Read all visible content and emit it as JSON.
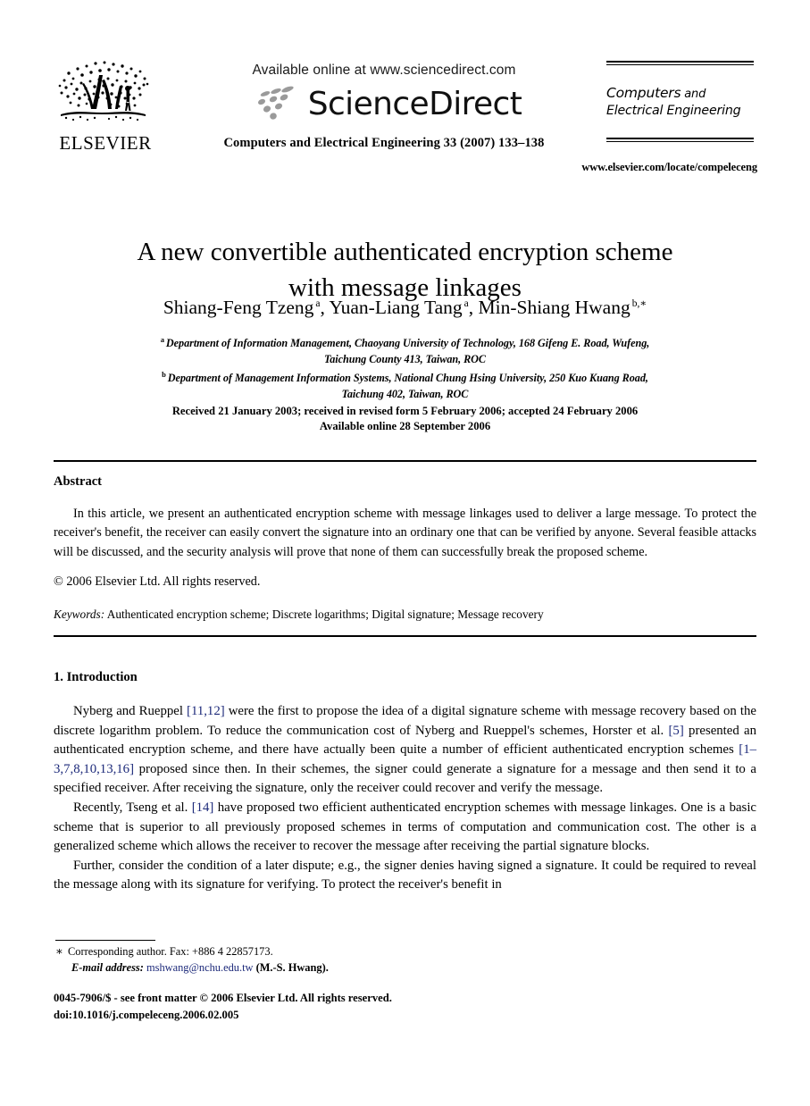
{
  "masthead": {
    "publisher_name": "ELSEVIER",
    "publisher_logo_icon": "elsevier-tree-icon",
    "available_online": "Available online at www.sciencedirect.com",
    "sciencedirect_wordmark": "ScienceDirect",
    "sciencedirect_logo_icon": "sciencedirect-swoosh-icon",
    "journal_reference": "Computers and Electrical Engineering 33 (2007) 133–138",
    "journal_logo_line1_strong": "Computers",
    "journal_logo_line1_weak": " and",
    "journal_logo_line2": "Electrical Engineering",
    "journal_url": "www.elsevier.com/locate/compeleceng"
  },
  "article": {
    "title_line1": "A new convertible authenticated encryption scheme",
    "title_line2": "with message linkages",
    "authors": [
      {
        "name": "Shiang-Feng Tzeng",
        "marker": "a",
        "sep": ", "
      },
      {
        "name": "Yuan-Liang Tang",
        "marker": "a",
        "sep": ", "
      },
      {
        "name": "Min-Shiang Hwang",
        "marker": "b,∗",
        "sep": ""
      }
    ],
    "affiliations": [
      {
        "marker": "a",
        "line1": "Department of Information Management, Chaoyang University of Technology, 168 Gifeng E. Road, Wufeng,",
        "line2": "Taichung County 413, Taiwan, ROC"
      },
      {
        "marker": "b",
        "line1": "Department of Management Information Systems, National Chung Hsing University, 250 Kuo Kuang Road,",
        "line2": "Taichung 402, Taiwan, ROC"
      }
    ],
    "dates_line1": "Received 21 January 2003; received in revised form 5 February 2006; accepted 24 February 2006",
    "dates_line2": "Available online 28 September 2006"
  },
  "abstract": {
    "heading": "Abstract",
    "text": "In this article, we present an authenticated encryption scheme with message linkages used to deliver a large message. To protect the receiver's benefit, the receiver can easily convert the signature into an ordinary one that can be verified by anyone. Several feasible attacks will be discussed, and the security analysis will prove that none of them can successfully break the proposed scheme.",
    "copyright": "© 2006 Elsevier Ltd. All rights reserved.",
    "keywords_label": "Keywords:",
    "keywords_value": "Authenticated encryption scheme; Discrete logarithms; Digital signature; Message recovery"
  },
  "section": {
    "heading": "1. Introduction",
    "paragraph1_a": "Nyberg and Rueppel ",
    "paragraph1_cite1": "[11,12]",
    "paragraph1_b": " were the first to propose the idea of a digital signature scheme with message recovery based on the discrete logarithm problem. To reduce the communication cost of Nyberg and Rueppel's schemes, Horster et al. ",
    "paragraph1_cite2": "[5]",
    "paragraph1_c": " presented an authenticated encryption scheme, and there have actually been quite a number of efficient authenticated encryption schemes ",
    "paragraph1_cite3": "[1–3,7,8,10,13,16]",
    "paragraph1_d": " proposed since then. In their schemes, the signer could generate a signature for a message and then send it to a specified receiver. After receiving the signature, only the receiver could recover and verify the message.",
    "paragraph2_a": "Recently, Tseng et al. ",
    "paragraph2_cite1": "[14]",
    "paragraph2_b": " have proposed two efficient authenticated encryption schemes with message linkages. One is a basic scheme that is superior to all previously proposed schemes in terms of computation and communication cost. The other is a generalized scheme which allows the receiver to recover the message after receiving the partial signature blocks.",
    "paragraph3": "Further, consider the condition of a later dispute; e.g., the signer denies having signed a signature. It could be required to reveal the message along with its signature for verifying. To protect the receiver's benefit in"
  },
  "footer": {
    "footnote_marker": "∗",
    "footnote_line1": "Corresponding author. Fax: +886 4 22857173.",
    "footnote_email_label": "E-mail address:",
    "footnote_email": "mshwang@nchu.edu.tw",
    "footnote_email_owner": "(M.-S. Hwang).",
    "imprint_line1": "0045-7906/$ - see front matter © 2006 Elsevier Ltd. All rights reserved.",
    "imprint_line2": "doi:10.1016/j.compeleceng.2006.02.005"
  },
  "colors": {
    "citation_link": "#1d2a7a",
    "email_link": "#1d2a7a",
    "logo_gray": "#9a9a9a",
    "text": "#000000"
  }
}
